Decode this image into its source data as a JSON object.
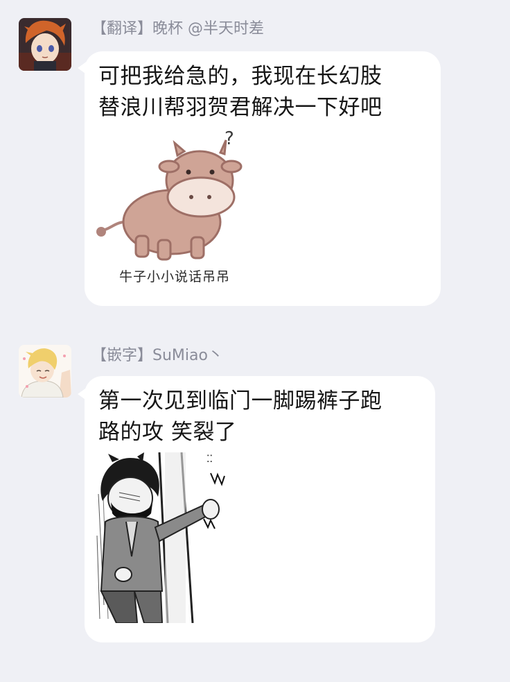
{
  "messages": [
    {
      "sender": "【翻译】晚杯 @半天时差",
      "text": "可把我给急的，我现在长幻肢\n替浪川帮羽贺君解决一下好吧",
      "sticker_caption": "牛子小小说话吊吊",
      "sticker_icon": "cow-sticker-icon"
    },
    {
      "sender": "【嵌字】SuMiao丶",
      "text": "第一次见到临门一脚踢裤子跑\n路的攻 笑裂了",
      "sticker_icon": "manga-panel-image"
    }
  ],
  "colors": {
    "background": "#eff0f5",
    "bubble": "#ffffff",
    "sender_text": "#8a8c99",
    "message_text": "#161616"
  }
}
